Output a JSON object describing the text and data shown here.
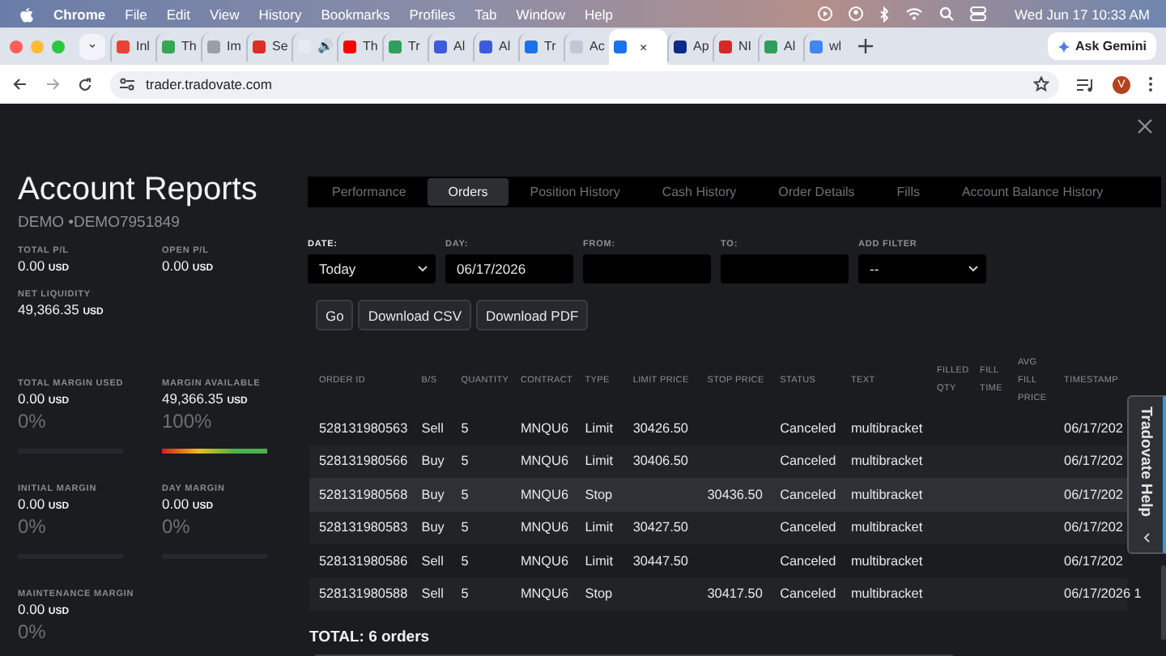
{
  "menu_bar": {
    "app": "Chrome",
    "menus": [
      "File",
      "Edit",
      "View",
      "History",
      "Bookmarks",
      "Profiles",
      "Tab",
      "Window",
      "Help"
    ],
    "clock": "Wed Jun 17  10:33 AM"
  },
  "browser": {
    "tabs": [
      {
        "title": "Inl",
        "color": "#ea4335",
        "selected": false
      },
      {
        "title": "Th",
        "color": "#34a853",
        "selected": false
      },
      {
        "title": "Im",
        "color": "#9aa0a6",
        "selected": false
      },
      {
        "title": "Se",
        "color": "#d93025",
        "selected": false
      },
      {
        "title": "🔊",
        "color": "#e8eaf0",
        "selected": false
      },
      {
        "title": "Th",
        "color": "#ff0000",
        "selected": false
      },
      {
        "title": "Tr",
        "color": "#2e9f5a",
        "selected": false
      },
      {
        "title": "Al",
        "color": "#3b5bdb",
        "selected": false
      },
      {
        "title": "Al",
        "color": "#3b5bdb",
        "selected": false
      },
      {
        "title": "Tr",
        "color": "#1a73e8",
        "selected": false
      },
      {
        "title": "Ac",
        "color": "#c0c8d8",
        "selected": false
      },
      {
        "title": "×",
        "color": "#1a73e8",
        "selected": true
      },
      {
        "title": "Ap",
        "color": "#0b2a8a",
        "selected": false
      },
      {
        "title": "NI",
        "color": "#d62828",
        "selected": false
      },
      {
        "title": "Al",
        "color": "#2e9f5a",
        "selected": false
      },
      {
        "title": "wl",
        "color": "#4285f4",
        "selected": false
      }
    ],
    "ask_button": "Ask Gemini",
    "url": "trader.tradovate.com",
    "avatar": "V"
  },
  "account": {
    "title": "Account Reports",
    "account_id": "DEMO •DEMO7951849",
    "stats": [
      {
        "label": "TOTAL P/L",
        "value": "0.00",
        "unit": "USD"
      },
      {
        "label": "OPEN P/L",
        "value": "0.00",
        "unit": "USD"
      },
      {
        "label": "NET LIQUIDITY",
        "value": "49,366.35",
        "unit": "USD"
      }
    ],
    "margins": [
      {
        "label": "TOTAL MARGIN USED",
        "value": "0.00",
        "unit": "USD",
        "percent": "0%",
        "level": 0
      },
      {
        "label": "MARGIN AVAILABLE",
        "value": "49,366.35",
        "unit": "USD",
        "percent": "100%",
        "level": 1
      },
      {
        "label": "INITIAL MARGIN",
        "value": "0.00",
        "unit": "USD",
        "percent": "0%",
        "level": 0
      },
      {
        "label": "DAY MARGIN",
        "value": "0.00",
        "unit": "USD",
        "percent": "0%",
        "level": 0
      },
      {
        "label": "MAINTENANCE MARGIN",
        "value": "0.00",
        "unit": "USD",
        "percent": "0%"
      }
    ]
  },
  "reports": {
    "tabs": [
      {
        "label": "Performance",
        "selected": false
      },
      {
        "label": "Orders",
        "selected": true
      },
      {
        "label": "Position History",
        "selected": false
      },
      {
        "label": "Cash History",
        "selected": false
      },
      {
        "label": "Order Details",
        "selected": false
      },
      {
        "label": "Fills",
        "selected": false
      },
      {
        "label": "Account Balance History",
        "selected": false
      }
    ],
    "filters": [
      {
        "label": "DATE:",
        "kind": "select",
        "value": "Today"
      },
      {
        "label": "DAY:",
        "kind": "input",
        "value": "06/17/2026"
      },
      {
        "label": "FROM:",
        "kind": "input"
      },
      {
        "label": "TO:",
        "kind": "input"
      },
      {
        "label": "ADD FILTER",
        "kind": "select",
        "value": "--"
      }
    ],
    "buttons": [
      "Go",
      "Download CSV",
      "Download PDF"
    ],
    "table": {
      "columns": [
        "ORDER ID",
        "B/S",
        "QUANTITY",
        "CONTRACT",
        "TYPE",
        "LIMIT PRICE",
        "STOP PRICE",
        "STATUS",
        "TEXT",
        "FILLED QTY",
        "FILL TIME",
        "AVG FILL PRICE",
        "TIMESTAMP"
      ],
      "rows": [
        {
          "cells": [
            "528131980563",
            "Sell",
            "5",
            "MNQU6",
            "Limit",
            "30426.50",
            null,
            "Canceled",
            "multibracket",
            null,
            null,
            null,
            "06/17/202"
          ],
          "selected": false
        },
        {
          "cells": [
            "528131980566",
            "Buy",
            "5",
            "MNQU6",
            "Limit",
            "30406.50",
            null,
            "Canceled",
            "multibracket",
            null,
            null,
            null,
            "06/17/202"
          ],
          "selected": false
        },
        {
          "cells": [
            "528131980568",
            "Buy",
            "5",
            "MNQU6",
            "Stop",
            null,
            "30436.50",
            "Canceled",
            "multibracket",
            null,
            null,
            null,
            "06/17/202"
          ],
          "selected": true
        },
        {
          "cells": [
            "528131980583",
            "Buy",
            "5",
            "MNQU6",
            "Limit",
            "30427.50",
            null,
            "Canceled",
            "multibracket",
            null,
            null,
            null,
            "06/17/202"
          ],
          "selected": false
        },
        {
          "cells": [
            "528131980586",
            "Sell",
            "5",
            "MNQU6",
            "Limit",
            "30447.50",
            null,
            "Canceled",
            "multibracket",
            null,
            null,
            null,
            "06/17/202"
          ],
          "selected": false
        },
        {
          "cells": [
            "528131980588",
            "Sell",
            "5",
            "MNQU6",
            "Stop",
            null,
            "30417.50",
            "Canceled",
            "multibracket",
            null,
            null,
            null,
            "06/17/2026 1"
          ],
          "selected": false
        }
      ]
    },
    "total": "TOTAL: 6 orders",
    "help_tab": "Tradovate Help"
  }
}
